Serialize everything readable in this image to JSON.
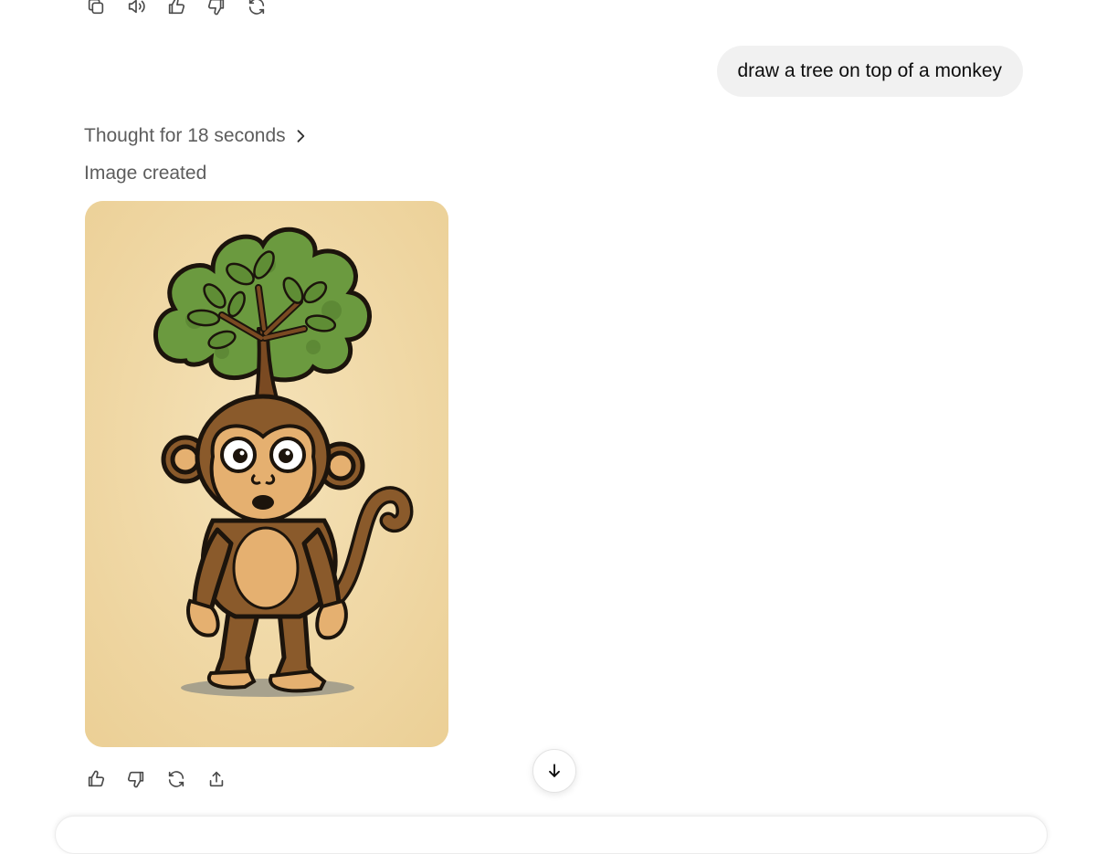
{
  "conversation": {
    "user_message": "draw a tree on top of a monkey",
    "thought_label": "Thought for 18 seconds",
    "status_label": "Image created"
  },
  "top_actions": {
    "icons": [
      "copy-icon",
      "read-aloud-icon",
      "thumbs-up-icon",
      "thumbs-down-icon",
      "regenerate-icon"
    ]
  },
  "bottom_actions": {
    "icons": [
      "thumbs-up-icon",
      "thumbs-down-icon",
      "regenerate-icon",
      "share-icon"
    ]
  },
  "image": {
    "background_color": "#f0d9a8",
    "leaf_color": "#6b9a3f",
    "fur_color": "#8a5a2b",
    "face_color": "#e5b070"
  },
  "scroll": {
    "icon": "arrow-down-icon"
  }
}
